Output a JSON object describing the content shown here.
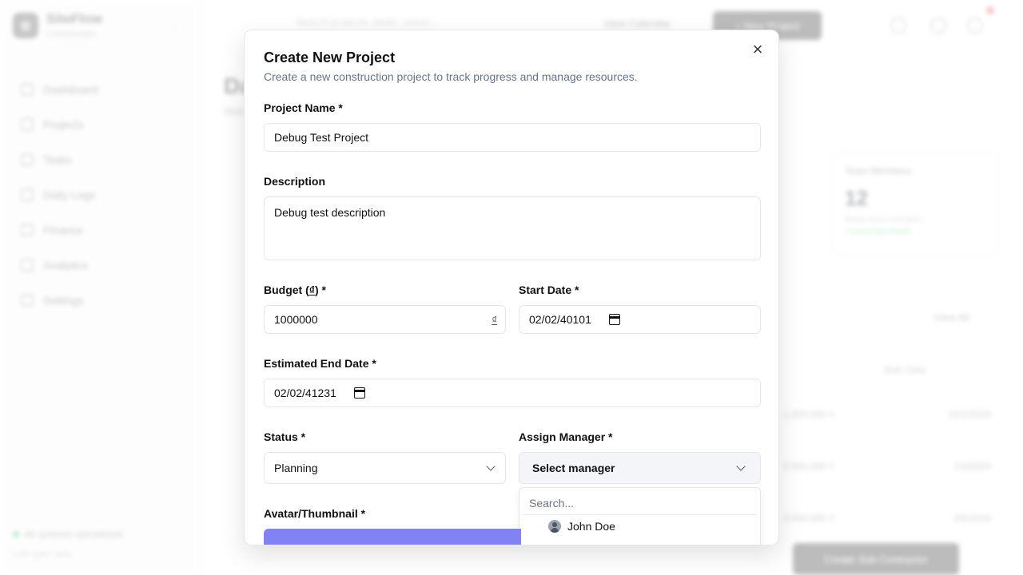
{
  "background": {
    "brand": {
      "name": "SiteFlow",
      "sub": "Construction"
    },
    "nav": [
      "Dashboard",
      "Projects",
      "Tasks",
      "Daily Logs",
      "Finance",
      "Analytics",
      "Settings"
    ],
    "top": {
      "search_placeholder": "Search projects, tasks, users...",
      "calendar": "View Calendar",
      "new_project": "+ New Project"
    },
    "page_title": "Dashboard",
    "page_sub": "Welcome back",
    "stat": {
      "label": "Team Members",
      "value": "12",
      "note": "Active team members",
      "trend": "+2 from last month"
    },
    "view_all": "View All",
    "col_head": "Start Date",
    "rows": [
      {
        "amount": "1.000.000 ₫",
        "date": "12/1/2024"
      },
      {
        "amount": "2.500.000 ₫",
        "date": "1/3/2024"
      },
      {
        "amount": "3.000.000 ₫",
        "date": "2/5/2024"
      }
    ],
    "sync": "All systems operational",
    "sync_sub": "Last sync: now",
    "bottom_button": "Create Sub Contractor"
  },
  "modal": {
    "title": "Create New Project",
    "description": "Create a new construction project to track progress and manage resources.",
    "project_name": {
      "label": "Project Name *",
      "value": "Debug Test Project"
    },
    "desc_field": {
      "label": "Description",
      "value": "Debug test description"
    },
    "budget": {
      "label_prefix": "Budget (",
      "currency": "₫",
      "label_suffix": ") *",
      "value": "1000000"
    },
    "start_date": {
      "label": "Start Date *",
      "value": "02/02/40101"
    },
    "end_date": {
      "label": "Estimated End Date *",
      "value": "02/02/41231"
    },
    "status": {
      "label": "Status *",
      "value": "Planning"
    },
    "manager": {
      "label": "Assign Manager *",
      "value": "Select manager",
      "search_placeholder": "Search...",
      "options": [
        "John Doe"
      ]
    },
    "avatar": {
      "label": "Avatar/Thumbnail *"
    }
  },
  "colors": {
    "accent": "#8183f4",
    "select_bg": "#f3f5f8",
    "muted": "#64748b"
  }
}
